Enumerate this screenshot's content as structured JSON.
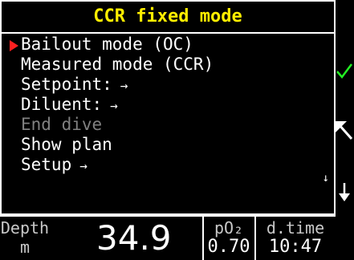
{
  "menu": {
    "title": "CCR fixed mode",
    "items": [
      {
        "label": "Bailout mode (OC)",
        "arrow": "",
        "enabled": true
      },
      {
        "label": "Measured mode (CCR)",
        "arrow": "",
        "enabled": true
      },
      {
        "label": "Setpoint:",
        "arrow": "→",
        "enabled": true
      },
      {
        "label": "Diluent:",
        "arrow": "→",
        "enabled": true
      },
      {
        "label": "End dive",
        "arrow": "",
        "enabled": false
      },
      {
        "label": "Show plan",
        "arrow": "",
        "enabled": true
      },
      {
        "label": "Setup",
        "arrow": "→",
        "enabled": true
      }
    ],
    "scroll_indicator": "↓"
  },
  "status": {
    "depth_label": "Depth",
    "depth_unit": "m",
    "depth_value": "34.9",
    "po2_label": "pO₂",
    "po2_value": "0.70",
    "dtime_label": "d.time",
    "dtime_value": "10:47"
  },
  "colors": {
    "title": "#ffee00",
    "selection_marker": "#ff2020",
    "check": "#22ee22",
    "disabled_text": "#808080"
  },
  "icons": {
    "selection": "triangle-right-icon",
    "check": "check-icon",
    "back": "up-left-arrow-icon",
    "scroll": "down-arrow-icon"
  }
}
